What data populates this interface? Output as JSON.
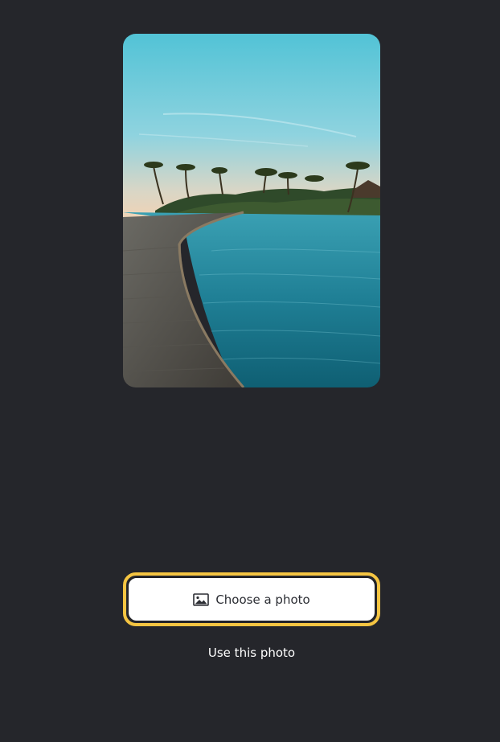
{
  "preview": {
    "image_description_icon": "landscape-photo",
    "alt": "Photo preview"
  },
  "actions": {
    "choose_label": "Choose a photo",
    "choose_icon": "image-icon",
    "use_label": "Use this photo"
  },
  "colors": {
    "background": "#25262b",
    "focus_ring": "#f5c542",
    "button_bg": "#ffffff",
    "button_text": "#2b2d33",
    "link_text": "#ffffff"
  }
}
